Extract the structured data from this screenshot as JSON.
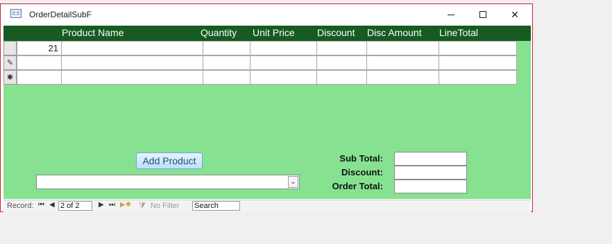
{
  "window": {
    "title": "OrderDetailSubF",
    "icon": "form-icon"
  },
  "columns": [
    "Product Name",
    "Quantity",
    "Unit Price",
    "Discount",
    "Disc Amount",
    "LineTotal"
  ],
  "rows": [
    {
      "selector": "",
      "id": "21",
      "cells": [
        "",
        "",
        "",
        "",
        "",
        ""
      ]
    },
    {
      "selector": "✎",
      "id": "",
      "cells": [
        "",
        "",
        "",
        "",
        "",
        ""
      ]
    },
    {
      "selector": "✱",
      "id": "",
      "cells": [
        "",
        "",
        "",
        "",
        "",
        ""
      ]
    }
  ],
  "buttons": {
    "add_product": "Add Product"
  },
  "product_combo": {
    "value": ""
  },
  "totals": {
    "subtotal_label": "Sub Total:",
    "discount_label": "Discount:",
    "order_total_label": "Order Total:",
    "subtotal_value": "",
    "discount_value": "",
    "order_total_value": ""
  },
  "status": {
    "record_label": "Record:",
    "record_position": "2 of 2",
    "filter_label": "No Filter",
    "search_label": "Search"
  },
  "colors": {
    "form_bg": "#86e290",
    "header_bg": "#175a22",
    "window_border": "#c8202f"
  }
}
